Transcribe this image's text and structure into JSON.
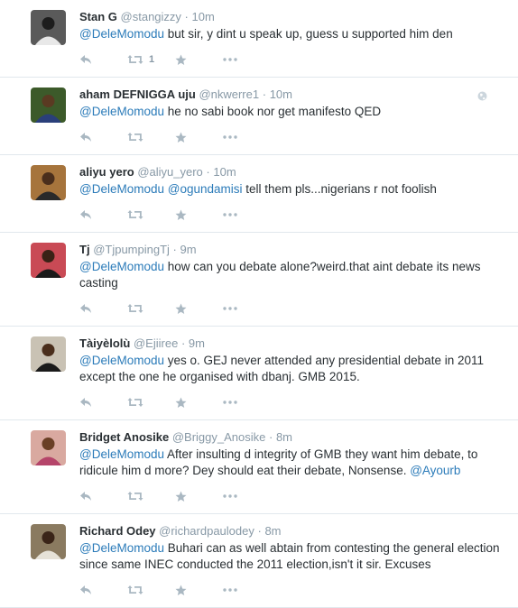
{
  "tweets": [
    {
      "fullname": "Stan G",
      "username": "@stangizzy",
      "time": "10m",
      "segments": [
        {
          "t": "@DeleMomodu",
          "m": true
        },
        {
          "t": " but sir, y dint u speak up, guess u supported him den",
          "m": false
        }
      ],
      "retweet_count": "1",
      "avatar": {
        "bg": "#5a5a5a",
        "skin": "#1d1d1d",
        "shirt": "#e8e8e8"
      }
    },
    {
      "fullname": "aham DEFNIGGA uju",
      "username": "@nkwerre1",
      "time": "10m",
      "segments": [
        {
          "t": "@DeleMomodu",
          "m": true
        },
        {
          "t": " he no sabi book nor get manifesto QED",
          "m": false
        }
      ],
      "show_globe": true,
      "avatar": {
        "bg": "#3c5a2a",
        "skin": "#5a3a22",
        "shirt": "#2a3f7a"
      }
    },
    {
      "fullname": "aliyu yero",
      "username": "@aliyu_yero",
      "time": "10m",
      "segments": [
        {
          "t": "@DeleMomodu",
          "m": true
        },
        {
          "t": " ",
          "m": false
        },
        {
          "t": "@ogundamisi",
          "m": true
        },
        {
          "t": " tell them pls...nigerians r not foolish",
          "m": false
        }
      ],
      "avatar": {
        "bg": "#a6743c",
        "skin": "#4a2e1c",
        "shirt": "#2a2a2a"
      }
    },
    {
      "fullname": "Tj",
      "username": "@TjpumpingTj",
      "time": "9m",
      "segments": [
        {
          "t": "@DeleMomodu",
          "m": true
        },
        {
          "t": " how can you debate alone?weird.that aint debate its news casting",
          "m": false
        }
      ],
      "avatar": {
        "bg": "#c94a55",
        "skin": "#3a2216",
        "shirt": "#1a1a1a"
      }
    },
    {
      "fullname": "Tàiyèlolù",
      "username": "@Ejiiree",
      "time": "9m",
      "segments": [
        {
          "t": "@DeleMomodu",
          "m": true
        },
        {
          "t": " yes o. GEJ never attended any presidential debate in 2011 except the one he organised with dbanj.  GMB 2015.",
          "m": false
        }
      ],
      "avatar": {
        "bg": "#c9c2b4",
        "skin": "#4a2e1c",
        "shirt": "#1a1a1a"
      }
    },
    {
      "fullname": "Bridget Anosike",
      "username": "@Briggy_Anosike",
      "time": "8m",
      "segments": [
        {
          "t": "@DeleMomodu",
          "m": true
        },
        {
          "t": " After insulting d integrity of GMB they want him debate, to ridicule him d more? Dey should eat their debate, Nonsense. ",
          "m": false
        },
        {
          "t": "@Ayourb",
          "m": true
        }
      ],
      "avatar": {
        "bg": "#d9a9a0",
        "skin": "#6a3f25",
        "shirt": "#b5456a"
      }
    },
    {
      "fullname": "Richard Odey",
      "username": "@richardpaulodey",
      "time": "8m",
      "segments": [
        {
          "t": "@DeleMomodu",
          "m": true
        },
        {
          "t": " Buhari can as well abtain from contesting the general election since same INEC conducted the 2011 election,isn't it sir. Excuses",
          "m": false
        }
      ],
      "avatar": {
        "bg": "#8a7a60",
        "skin": "#3a2418",
        "shirt": "#e6e2d8"
      }
    }
  ],
  "icons": {
    "reply": "reply-icon",
    "retweet": "retweet-icon",
    "favorite": "star-icon",
    "more": "more-icon",
    "globe": "globe-icon"
  },
  "colors": {
    "mention": "#2b7bb9",
    "meta": "#8899a6",
    "action_icon": "#aab8c2",
    "divider": "#e1e8ed"
  }
}
